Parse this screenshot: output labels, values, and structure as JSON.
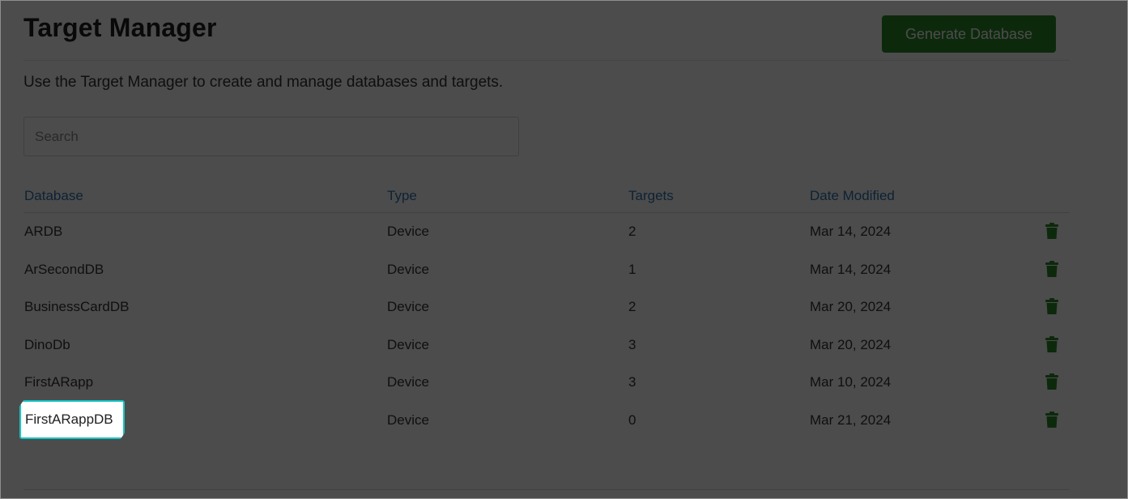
{
  "header": {
    "title": "Target Manager",
    "generate_button_label": "Generate Database"
  },
  "description": "Use the Target Manager to create and manage databases and targets.",
  "search": {
    "placeholder": "Search",
    "value": ""
  },
  "table": {
    "columns": {
      "database": "Database",
      "type": "Type",
      "targets": "Targets",
      "date_modified": "Date Modified"
    },
    "rows": [
      {
        "database": "ARDB",
        "type": "Device",
        "targets": "2",
        "date_modified": "Mar 14, 2024"
      },
      {
        "database": "ArSecondDB",
        "type": "Device",
        "targets": "1",
        "date_modified": "Mar 14, 2024"
      },
      {
        "database": "BusinessCardDB",
        "type": "Device",
        "targets": "2",
        "date_modified": "Mar 20, 2024"
      },
      {
        "database": "DinoDb",
        "type": "Device",
        "targets": "3",
        "date_modified": "Mar 20, 2024"
      },
      {
        "database": "FirstARapp",
        "type": "Device",
        "targets": "3",
        "date_modified": "Mar 10, 2024"
      },
      {
        "database": "FirstARappDB",
        "type": "Device",
        "targets": "0",
        "date_modified": "Mar 21, 2024"
      }
    ]
  },
  "icons": {
    "delete": "trash-icon"
  },
  "colors": {
    "accent_green": "#2e8b2a",
    "link_blue": "#2f74b0",
    "spotlight_border": "#12c6c4"
  }
}
